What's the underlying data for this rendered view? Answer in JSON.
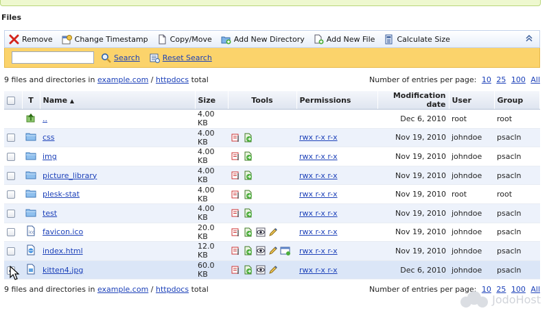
{
  "section_title": "Files",
  "toolbar": {
    "buttons": [
      {
        "label": "Remove",
        "icon": "remove-icon"
      },
      {
        "label": "Change Timestamp",
        "icon": "timestamp-icon"
      },
      {
        "label": "Copy/Move",
        "icon": "copy-move-icon"
      },
      {
        "label": "Add New Directory",
        "icon": "add-directory-icon"
      },
      {
        "label": "Add New File",
        "icon": "add-file-icon"
      },
      {
        "label": "Calculate Size",
        "icon": "calculate-size-icon"
      }
    ],
    "collapse_icon": "double-chevron-up-icon"
  },
  "search": {
    "value": "",
    "search_label": "Search",
    "reset_label": "Reset Search"
  },
  "summary": {
    "prefix": "9 files and directories in",
    "domain": "example.com",
    "separator": "/",
    "folder": "httpdocs",
    "suffix": "total",
    "per_page_label": "Number of entries per page:",
    "per_page_options": [
      "10",
      "25",
      "100",
      "All"
    ]
  },
  "table": {
    "headers": {
      "t": "T",
      "name": "Name",
      "size": "Size",
      "tools": "Tools",
      "permissions": "Permissions",
      "modified": "Modification date",
      "user": "User",
      "group": "Group"
    },
    "rows": [
      {
        "type": "up",
        "name": "..",
        "size": "4.00 KB",
        "tools": [],
        "permissions": "",
        "modified": "Dec 6, 2010",
        "user": "root",
        "group": "root",
        "checkbox": false,
        "checked": false
      },
      {
        "type": "folder",
        "name": "css",
        "size": "4.00 KB",
        "tools": [
          "rename",
          "copy"
        ],
        "permissions": "rwx r-x r-x",
        "modified": "Nov 19, 2010",
        "user": "johndoe",
        "group": "psacln",
        "checkbox": true,
        "checked": false
      },
      {
        "type": "folder",
        "name": "img",
        "size": "4.00 KB",
        "tools": [
          "rename",
          "copy"
        ],
        "permissions": "rwx r-x r-x",
        "modified": "Nov 19, 2010",
        "user": "johndoe",
        "group": "psacln",
        "checkbox": true,
        "checked": false
      },
      {
        "type": "folder",
        "name": "picture_library",
        "size": "4.00 KB",
        "tools": [
          "rename",
          "copy"
        ],
        "permissions": "rwx r-x r-x",
        "modified": "Nov 19, 2010",
        "user": "johndoe",
        "group": "psacln",
        "checkbox": true,
        "checked": false
      },
      {
        "type": "folder",
        "name": "plesk-stat",
        "size": "4.00 KB",
        "tools": [
          "rename",
          "copy"
        ],
        "permissions": "rwx r-x r-x",
        "modified": "Nov 19, 2010",
        "user": "root",
        "group": "root",
        "checkbox": true,
        "checked": false
      },
      {
        "type": "folder",
        "name": "test",
        "size": "4.00 KB",
        "tools": [
          "rename",
          "copy"
        ],
        "permissions": "rwx r-x r-x",
        "modified": "Nov 19, 2010",
        "user": "johndoe",
        "group": "psacln",
        "checkbox": true,
        "checked": false
      },
      {
        "type": "file-ico",
        "name": "favicon.ico",
        "size": "20.0 KB",
        "tools": [
          "rename",
          "copy",
          "view",
          "edit"
        ],
        "permissions": "rwx r-x r-x",
        "modified": "Nov 19, 2010",
        "user": "johndoe",
        "group": "psacln",
        "checkbox": true,
        "checked": false
      },
      {
        "type": "file-html",
        "name": "index.html",
        "size": "12.0 KB",
        "tools": [
          "rename",
          "copy",
          "view",
          "edit",
          "html-edit"
        ],
        "permissions": "rwx r-x r-x",
        "modified": "Nov 19, 2010",
        "user": "johndoe",
        "group": "psacln",
        "checkbox": true,
        "checked": false
      },
      {
        "type": "file-img",
        "name": "kitten4.jpg",
        "size": "60.0 KB",
        "tools": [
          "rename",
          "copy",
          "view",
          "edit"
        ],
        "permissions": "rwx r-x r-x",
        "modified": "Dec 6, 2010",
        "user": "johndoe",
        "group": "psacln",
        "checkbox": true,
        "checked": true
      }
    ]
  },
  "watermark": "JodoHost",
  "colors": {
    "toolbar_bg": "#e7eefa",
    "search_bg": "#fbd36b",
    "link": "#1a3fb8",
    "row_alt": "#edf2fb"
  }
}
